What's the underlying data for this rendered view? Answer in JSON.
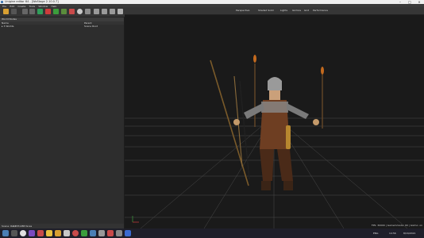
{
  "window": {
    "title": "Unigine editor 64 - [WoStage 2.10.0.7]"
  },
  "menubar": {
    "items": [
      "File",
      "Edit",
      "Create",
      "Tools",
      "Window",
      "Help"
    ]
  },
  "left_panel": {
    "title": "World Nodes",
    "columns": [
      "Name",
      "Parent"
    ],
    "rows": [
      {
        "name": "▸ 3 Worlds",
        "parent": "Scene Root"
      }
    ],
    "bottom": {
      "left": "Scene: Root",
      "right": "2,033,088 faces"
    }
  },
  "viewport": {
    "toolbar": [
      "Perspective",
      "Shaded Solid",
      "Lights",
      "Gizmos",
      "Grid",
      "Performance"
    ],
    "status": "FPS: 30000 | Gamemmode: 60 | Gizmo: on"
  },
  "taskbar": {
    "time": "14:56",
    "date": "8/16/2021",
    "lang": "ENG"
  },
  "colors": {
    "accent": "#4a7fb5",
    "grid": "#5a5a5a",
    "bg": "#1a1a1a"
  }
}
